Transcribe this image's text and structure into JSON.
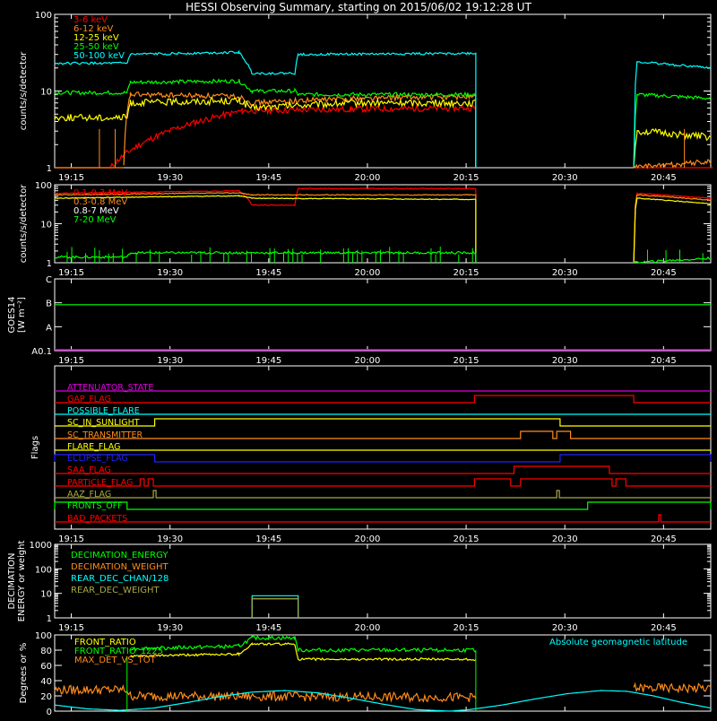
{
  "title": "HESSI Observing Summary, starting on 2015/06/02 19:12:28 UT",
  "time_ticks": [
    "19:15",
    "19:30",
    "19:45",
    "20:00",
    "20:15",
    "20:30",
    "20:45"
  ],
  "colors": {
    "red": "#ff0000",
    "orange": "#ff8c1a",
    "yellow": "#ffff00",
    "green": "#00ff00",
    "cyan": "#00ffff",
    "magenta": "#e000e0",
    "blue": "#2222ff",
    "olive": "#aaaa44",
    "white": "#ffffff"
  },
  "panels": {
    "p1": {
      "ylabel": "counts/s/detector",
      "ytick_labels": [
        "1",
        "10",
        "100"
      ],
      "legend": [
        "3-6 keV",
        "6-12 keV",
        "12-25 keV",
        "25-50 keV",
        "50-100 keV"
      ]
    },
    "p2": {
      "ylabel": "counts/s/detector",
      "ytick_labels": [
        "1",
        "10",
        "100"
      ],
      "legend": [
        "0.1-0.3 MeV",
        "0.3-0.8 MeV",
        "0.8-7 MeV",
        "7-20 MeV"
      ]
    },
    "p3": {
      "ylabel": "GOES14",
      "ylabel2": "[W m⁻²]",
      "ytick_labels": [
        "A0.1",
        "A",
        "B",
        "C"
      ]
    },
    "p4": {
      "ylabel": "Flags",
      "flags": [
        "ATTENUATOR_STATE",
        "GAP_FLAG",
        "POSSIBLE_FLARE",
        "SC_IN_SUNLIGHT",
        "SC_TRANSMITTER",
        "FLARE_FLAG",
        "ECLIPSE_FLAG",
        "SAA_FLAG",
        "PARTICLE_FLAG",
        "AAZ_FLAG",
        "FRONTS_OFF",
        "BAD_PACKETS"
      ]
    },
    "p5": {
      "ylabel": "DECIMATION",
      "ylabel2": "ENERGY or weight",
      "ytick_labels": [
        "1",
        "10",
        "100",
        "1000"
      ],
      "legend": [
        "DECIMATION_ENERGY",
        "DECIMATION_WEIGHT",
        "REAR_DEC_CHAN/128",
        "REAR_DEC_WEIGHT"
      ]
    },
    "p6": {
      "ylabel": "Degrees or %",
      "ytick_labels": [
        "0",
        "20",
        "40",
        "60",
        "80",
        "100"
      ],
      "legend": [
        "FRONT_RATIO",
        "FRONT_RATIO_1225",
        "MAX_DET_VS_TOT"
      ],
      "legend_right": "Absolute geomagnetic latitude"
    }
  },
  "chart_data": {
    "type": "line",
    "x_unit": "minutes after 19:12:28 UT",
    "x_range": [
      0,
      99.7
    ],
    "panels": [
      {
        "name": "count rates",
        "yscale": "log",
        "ylim": [
          1,
          100
        ],
        "series": [
          {
            "name": "3-6 keV",
            "segments": [
              [
                [
                  0,
                  1
                ],
                [
                  8.5,
                  1
                ]
              ],
              [
                [
                  8.5,
                  1
                ],
                [
                  28.5,
                  5.5
                ],
                [
                  45,
                  5.8
                ],
                [
                  64,
                  6
                ],
                [
                  64,
                  1
                ]
              ],
              [
                [
                  88,
                  1
                ],
                [
                  100,
                  1
                ]
              ]
            ]
          },
          {
            "name": "6-12 keV",
            "segments": [
              [
                [
                  0,
                  1
                ],
                [
                  10.5,
                  1
                ]
              ],
              [
                [
                  10.5,
                  1
                ],
                [
                  11.5,
                  9
                ],
                [
                  28,
                  8.5
                ],
                [
                  30,
                  7
                ],
                [
                  45,
                  8
                ],
                [
                  64,
                  8.5
                ],
                [
                  64,
                  1
                ]
              ],
              [
                [
                  88,
                  1
                ],
                [
                  99.7,
                  1.2
                ]
              ]
            ]
          },
          {
            "name": "12-25 keV",
            "segments": [
              [
                [
                  0,
                  4.5
                ],
                [
                  11,
                  4.5
                ],
                [
                  11.5,
                  7
                ],
                [
                  28,
                  7.5
                ],
                [
                  30,
                  6
                ],
                [
                  45,
                  7
                ],
                [
                  64,
                  7
                ],
                [
                  64,
                  1
                ]
              ],
              [
                [
                  88,
                  1
                ],
                [
                  88.5,
                  3
                ],
                [
                  99.7,
                  2.5
                ]
              ]
            ]
          },
          {
            "name": "25-50 keV",
            "segments": [
              [
                [
                  0,
                  9.5
                ],
                [
                  11,
                  9.5
                ],
                [
                  11.5,
                  13
                ],
                [
                  28,
                  13.5
                ],
                [
                  30,
                  10
                ],
                [
                  36.5,
                  10
                ],
                [
                  37,
                  9
                ],
                [
                  64,
                  9
                ],
                [
                  64,
                  1
                ]
              ],
              [
                [
                  88,
                  1
                ],
                [
                  88.5,
                  9
                ],
                [
                  99.7,
                  8
                ]
              ]
            ]
          },
          {
            "name": "50-100 keV",
            "segments": [
              [
                [
                  0,
                  23
                ],
                [
                  11,
                  23
                ],
                [
                  11.5,
                  30
                ],
                [
                  28,
                  32
                ],
                [
                  30,
                  17
                ],
                [
                  36.5,
                  17
                ],
                [
                  37,
                  30
                ],
                [
                  64,
                  31
                ],
                [
                  64,
                  1
                ]
              ],
              [
                [
                  88,
                  1
                ],
                [
                  88.5,
                  24
                ],
                [
                  99.7,
                  20
                ]
              ]
            ]
          }
        ]
      },
      {
        "name": "high energy count rates",
        "yscale": "log",
        "ylim": [
          1,
          100
        ],
        "series": [
          {
            "name": "0.1-0.3 MeV",
            "segments": [
              [
                [
                  0,
                  60
                ],
                [
                  28,
                  70
                ],
                [
                  30,
                  30
                ],
                [
                  36.5,
                  30
                ],
                [
                  37,
                  80
                ],
                [
                  64,
                  80
                ],
                [
                  64,
                  1
                ]
              ],
              [
                [
                  88,
                  1
                ],
                [
                  88.5,
                  60
                ],
                [
                  99.7,
                  45
                ]
              ]
            ]
          },
          {
            "name": "0.3-0.8 MeV",
            "segments": [
              [
                [
                  0,
                  55
                ],
                [
                  28,
                  62
                ],
                [
                  30,
                  55
                ],
                [
                  64,
                  55
                ],
                [
                  64,
                  1
                ]
              ],
              [
                [
                  88,
                  1
                ],
                [
                  88.5,
                  55
                ],
                [
                  99.7,
                  40
                ]
              ]
            ]
          },
          {
            "name": "0.8-7 MeV",
            "segments": [
              [
                [
                  0,
                  45
                ],
                [
                  28,
                  52
                ],
                [
                  30,
                  45
                ],
                [
                  64,
                  42
                ],
                [
                  64,
                  1
                ]
              ],
              [
                [
                  88,
                  1
                ],
                [
                  88.5,
                  45
                ],
                [
                  99.7,
                  32
                ]
              ]
            ]
          },
          {
            "name": "7-20 MeV",
            "segments": [
              [
                [
                  0,
                  1.4
                ],
                [
                  11,
                  1.4
                ],
                [
                  11.5,
                  1.8
                ],
                [
                  64,
                  1.8
                ],
                [
                  64,
                  1
                ]
              ],
              [
                [
                  88,
                  1
                ],
                [
                  99.7,
                  1.3
                ]
              ]
            ]
          }
        ]
      },
      {
        "name": "GOES14",
        "series": [
          {
            "name": "GOES long",
            "values": [
              [
                0,
                8.3e-08
              ],
              [
                99.7,
                8.3e-08
              ]
            ]
          },
          {
            "name": "GOES short",
            "values": [
              [
                0,
                1e-08
              ],
              [
                99.7,
                1e-08
              ]
            ]
          }
        ]
      },
      {
        "name": "flags",
        "series": [
          {
            "name": "ATTENUATOR_STATE",
            "steps": []
          },
          {
            "name": "GAP_FLAG",
            "steps": [
              [
                63.8,
                88
              ]
            ]
          },
          {
            "name": "POSSIBLE_FLARE",
            "steps": []
          },
          {
            "name": "SC_IN_SUNLIGHT",
            "steps": [
              [
                15.2,
                76.8
              ]
            ]
          },
          {
            "name": "SC_TRANSMITTER",
            "steps": [
              [
                70.8,
                75.7
              ],
              [
                76.3,
                78.4
              ]
            ]
          },
          {
            "name": "FLARE_FLAG",
            "steps": []
          },
          {
            "name": "ECLIPSE_FLAG",
            "steps": [
              [
                0,
                15.2
              ],
              [
                76.8,
                99.7
              ]
            ]
          },
          {
            "name": "SAA_FLAG",
            "steps": [
              [
                69.8,
                84.3
              ]
            ]
          },
          {
            "name": "PARTICLE_FLAG",
            "steps": [
              [
                13,
                13.6
              ],
              [
                14.2,
                15
              ],
              [
                63.8,
                69.3
              ],
              [
                70.8,
                84.7
              ],
              [
                85.3,
                86.8
              ]
            ]
          },
          {
            "name": "AAZ_FLAG",
            "steps": [
              [
                15,
                15.4
              ],
              [
                76.3,
                76.7
              ]
            ]
          },
          {
            "name": "FRONTS_OFF",
            "steps": [
              [
                0,
                11
              ],
              [
                81,
                99.7
              ]
            ]
          },
          {
            "name": "BAD_PACKETS",
            "steps": [
              [
                91.8,
                92.1
              ]
            ]
          }
        ]
      },
      {
        "name": "decimation",
        "yscale": "log",
        "ylim": [
          1,
          1000
        ],
        "series": [
          {
            "name": "DECIMATION_ENERGY",
            "values": []
          },
          {
            "name": "DECIMATION_WEIGHT",
            "values": []
          },
          {
            "name": "REAR_DEC_CHAN/128",
            "values": [
              [
                30,
                8
              ],
              [
                37,
                8
              ]
            ]
          },
          {
            "name": "REAR_DEC_WEIGHT",
            "values": [
              [
                30,
                6
              ],
              [
                37,
                6
              ]
            ]
          }
        ]
      },
      {
        "name": "ratios",
        "ylim": [
          0,
          100
        ],
        "series": [
          {
            "name": "FRONT_RATIO",
            "segments": [
              [
                [
                  11.5,
                  72
                ],
                [
                  28,
                  75
                ],
                [
                  30,
                  88
                ],
                [
                  36.5,
                  88
                ],
                [
                  37,
                  68
                ],
                [
                  64,
                  68
                ]
              ]
            ]
          },
          {
            "name": "FRONT_RATIO_1225",
            "segments": [
              [
                [
                  11.5,
                  82
                ],
                [
                  28,
                  85
                ],
                [
                  30,
                  96
                ],
                [
                  36.5,
                  96
                ],
                [
                  37,
                  80
                ],
                [
                  64,
                  80
                ]
              ]
            ]
          },
          {
            "name": "MAX_DET_VS_TOT",
            "segments": [
              [
                [
                  0,
                  28
                ],
                [
                  11,
                  28
                ],
                [
                  11.5,
                  20
                ],
                [
                  64,
                  18
                ]
              ],
              [
                [
                  88,
                  30
                ],
                [
                  99.7,
                  30
                ]
              ]
            ]
          },
          {
            "name": "Absolute geomagnetic latitude",
            "segments": [
              [
                [
                  0,
                  8
                ],
                [
                  5,
                  3
                ],
                [
                  10,
                  1
                ],
                [
                  15,
                  4
                ],
                [
                  20,
                  11
                ],
                [
                  25,
                  19
                ],
                [
                  30,
                  25
                ],
                [
                  35,
                  27
                ],
                [
                  40,
                  24
                ],
                [
                  45,
                  17
                ],
                [
                  50,
                  9
                ],
                [
                  55,
                  2
                ],
                [
                  60,
                  0
                ],
                [
                  63,
                  2
                ],
                [
                  68,
                  8
                ],
                [
                  73,
                  16
                ],
                [
                  78,
                  23
                ],
                [
                  83,
                  27
                ],
                [
                  87,
                  26
                ],
                [
                  91,
                  20
                ],
                [
                  95,
                  12
                ],
                [
                  99.7,
                  4
                ]
              ]
            ]
          }
        ]
      }
    ]
  }
}
